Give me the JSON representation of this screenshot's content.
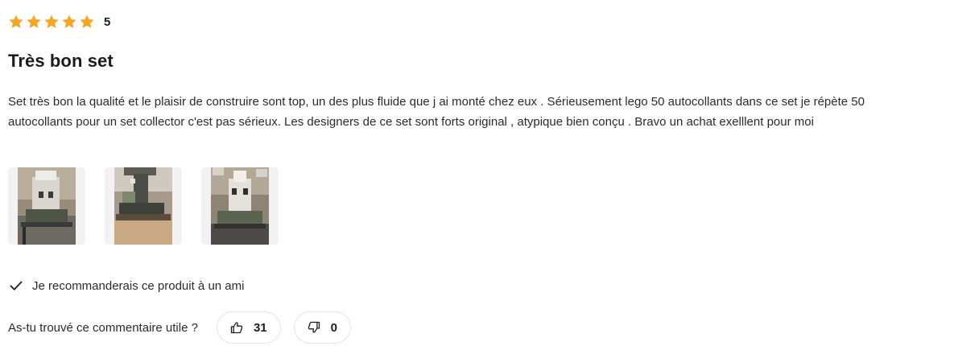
{
  "review": {
    "rating": {
      "stars_filled": 5,
      "stars_total": 5,
      "value": "5",
      "star_color": "#F5A623"
    },
    "title": "Très bon set",
    "body": "Set très bon la qualité et le plaisir de construire sont top, un des plus fluide que j ai monté chez eux . Sérieusement lego 50 autocollants dans ce set je répète 50 autocollants pour un set collector c'est pas sérieux. Les designers de ce set sont forts original , atypique bien conçu . Bravo un achat exelllent pour moi",
    "photos": [
      {
        "name": "review-photo-1"
      },
      {
        "name": "review-photo-2"
      },
      {
        "name": "review-photo-3"
      }
    ],
    "recommend": {
      "icon": "checkmark-icon",
      "text": "Je recommanderais ce produit à un ami"
    },
    "helpful": {
      "label": "As-tu trouvé ce commentaire utile ?",
      "up": {
        "icon": "thumbs-up-icon",
        "count": "31"
      },
      "down": {
        "icon": "thumbs-down-icon",
        "count": "0"
      }
    }
  }
}
